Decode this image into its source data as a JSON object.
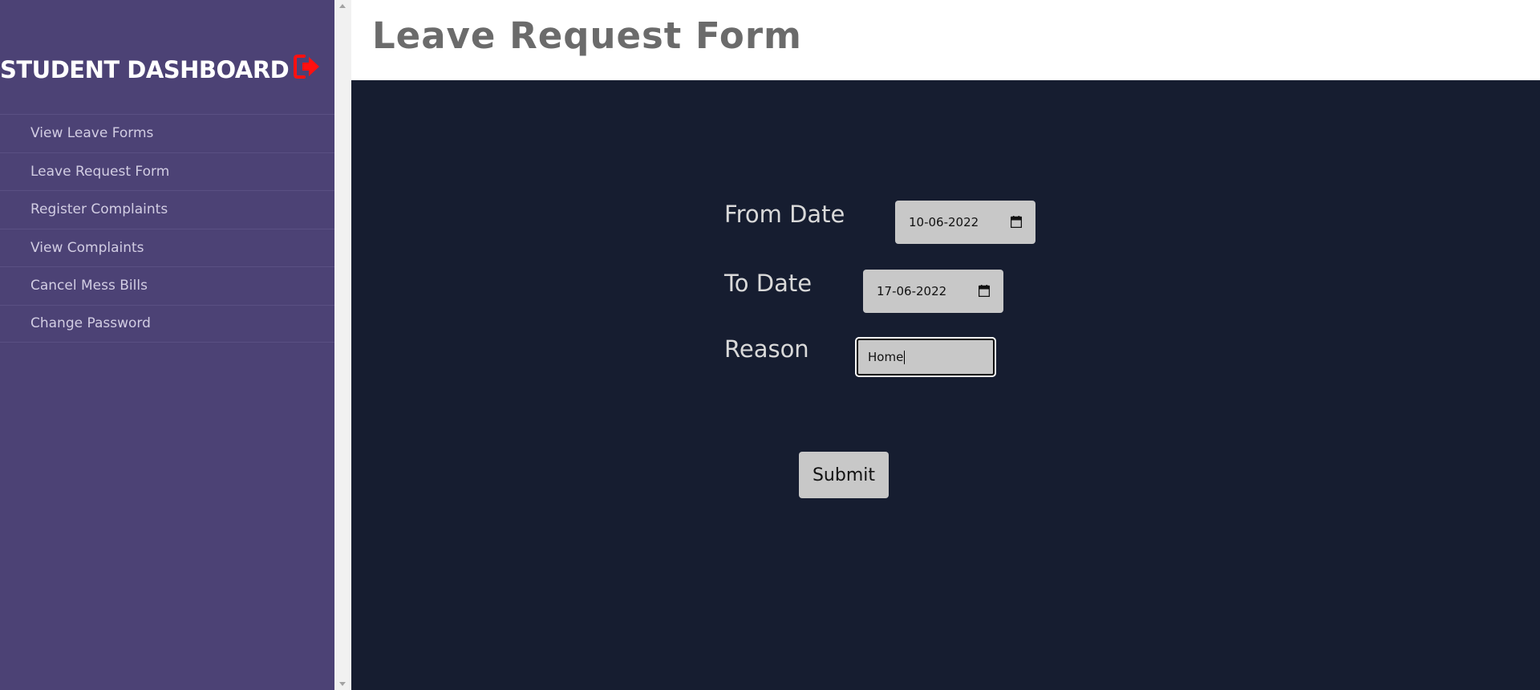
{
  "sidebar": {
    "title": "STUDENT DASHBOARD",
    "logout_icon": "logout-icon",
    "logout_icon_color": "#ff1010",
    "background": "#4c4275",
    "items": [
      {
        "label": "View Leave Forms"
      },
      {
        "label": "Leave Request Form"
      },
      {
        "label": "Register Complaints"
      },
      {
        "label": "View Complaints"
      },
      {
        "label": "Cancel Mess Bills"
      },
      {
        "label": "Change Password"
      }
    ]
  },
  "header": {
    "title": "Leave Request Form"
  },
  "form": {
    "from_date": {
      "label": "From Date",
      "value": "10-06-2022",
      "icon": "calendar-icon"
    },
    "to_date": {
      "label": "To Date",
      "value": "17-06-2022",
      "icon": "calendar-icon"
    },
    "reason": {
      "label": "Reason",
      "value": "Home"
    },
    "submit_label": "Submit",
    "background": "#161d30"
  }
}
